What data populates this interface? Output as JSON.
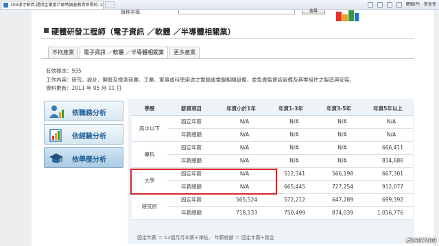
{
  "browser": {
    "tab_title": "104求才薪資-提供企業用戶即時調查薪資所得的...",
    "close_glyph": "×",
    "cmd_page": "網頁(P)",
    "cmd_safety": "安全性"
  },
  "search": {
    "label": "職務名稱",
    "button": "搜尋"
  },
  "page": {
    "title": "硬體研發工程師（電子資訊 ／軟體 ／半導體相關業）",
    "tabs": [
      "不拘產業",
      "電子資訊 ／軟體 ／半導體相關業",
      "更多產業"
    ],
    "active_tab": 1,
    "sample_label": "有效樣本：",
    "sample_value": "935",
    "job_content": "工作內容：研究、設計、開發及檢測商業、工業、軍事或科學用途之電腦或電腦相關設備，並負責監督該設備及其零組件之製造與安裝。",
    "update_label": "資料更新：",
    "update_value": "2011 年 05 月 11 日"
  },
  "side_menu": [
    {
      "label": "依職務分析",
      "icon": "person-chart-icon"
    },
    {
      "label": "依經驗分析",
      "icon": "experience-chart-icon"
    },
    {
      "label": "依學歷分析",
      "icon": "graduation-cap-icon"
    }
  ],
  "side_menu_active": 2,
  "table": {
    "headers": [
      "學歷",
      "薪資項目",
      "年資小於1年",
      "年資1-3年",
      "年資3-5年",
      "年資5年以上"
    ],
    "groups": [
      {
        "edu": "高中以下",
        "rows": [
          {
            "item": "固定年薪",
            "values": [
              "N/A",
              "N/A",
              "N/A",
              "N/A"
            ]
          },
          {
            "item": "年薪總額",
            "values": [
              "N/A",
              "N/A",
              "N/A",
              "N/A"
            ]
          }
        ]
      },
      {
        "edu": "專科",
        "rows": [
          {
            "item": "固定年薪",
            "values": [
              "N/A",
              "N/A",
              "N/A",
              "666,411"
            ]
          },
          {
            "item": "年薪總額",
            "values": [
              "N/A",
              "N/A",
              "N/A",
              "814,686"
            ]
          }
        ]
      },
      {
        "edu": "大學",
        "rows": [
          {
            "item": "固定年薪",
            "values": [
              "N/A",
              "512,341",
              "566,198",
              "667,301"
            ]
          },
          {
            "item": "年薪總額",
            "values": [
              "N/A",
              "665,445",
              "727,254",
              "912,077"
            ]
          }
        ]
      },
      {
        "edu": "研究所",
        "rows": [
          {
            "item": "固定年薪",
            "values": [
              "565,524",
              "572,212",
              "647,289",
              "699,392"
            ]
          },
          {
            "item": "年薪總額",
            "values": [
              "718,133",
              "750,499",
              "874,039",
              "1,016,776"
            ]
          }
        ]
      }
    ],
    "highlight_color": "#d6262c"
  },
  "footnote": "固定年薪 ＝ 12個月月本薪+津貼， 年薪總額 ＝ 固定年薪+獎金",
  "watermark": "#1687200"
}
